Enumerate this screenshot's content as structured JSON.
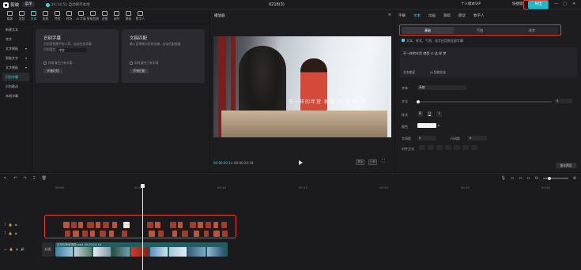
{
  "titlebar": {
    "app_name": "剪映",
    "menu_label": "菜单",
    "autosave": "14:14:51 自动保存本地",
    "doc_title": "0218(3)",
    "shortcuts": "快捷键",
    "pro_member": "个人版本VIP",
    "export_label": "导出",
    "win_min": "—",
    "win_max": "□",
    "win_close": "✕"
  },
  "toolbar": {
    "tools": [
      {
        "label": "媒体",
        "icon": "media-icon"
      },
      {
        "label": "音频",
        "icon": "audio-icon"
      },
      {
        "label": "文本",
        "icon": "text-icon",
        "active": true
      },
      {
        "label": "贴纸",
        "icon": "sticker-icon"
      },
      {
        "label": "特效",
        "icon": "effects-icon"
      },
      {
        "label": "转场",
        "icon": "transition-icon"
      },
      {
        "label": "AI 字幕",
        "icon": "ai-caption-icon"
      },
      {
        "label": "智能包装",
        "icon": "smart-pack-icon"
      },
      {
        "label": "滤镜",
        "icon": "filter-icon"
      },
      {
        "label": "调节",
        "icon": "adjust-icon"
      },
      {
        "label": "模板",
        "icon": "template-icon"
      },
      {
        "label": "数字人",
        "icon": "avatar-icon"
      }
    ]
  },
  "sidebar": {
    "items": [
      {
        "label": "新建文本"
      },
      {
        "label": "花字"
      },
      {
        "label": "文字模板"
      },
      {
        "label": "智能文字"
      },
      {
        "label": "文字模板"
      },
      {
        "label": "识别字幕",
        "active": true
      },
      {
        "label": "识别歌词"
      },
      {
        "label": "本地字幕"
      }
    ]
  },
  "content": {
    "card1": {
      "title": "识别字幕",
      "desc": "识别音视频中的人声，自动生成字幕",
      "lang_label": "识别语言",
      "lang_value": "中文",
      "check_label": "同时清空已有字幕",
      "button": "开始识别"
    },
    "card2": {
      "title": "文稿匹配",
      "desc": "输入音视频对应的文稿，自动匹配画面",
      "check_label": "同时清空已有字幕",
      "button": "开始匹配"
    }
  },
  "player": {
    "title": "播放器",
    "subtitle_text": "不一样的年货 就是 小 这 样 梦",
    "timecode_current": "00:00:00:14",
    "timecode_duration": "00:00:24:18",
    "btn_original": "原始",
    "btn_ratio": "比例"
  },
  "rpanel": {
    "tabs": [
      {
        "label": "字幕"
      },
      {
        "label": "文本",
        "active": true
      },
      {
        "label": "动画"
      },
      {
        "label": "跟踪"
      },
      {
        "label": "朗读"
      },
      {
        "label": "数字人"
      }
    ],
    "segments": [
      {
        "label": "基础",
        "active": true
      },
      {
        "label": "气泡"
      },
      {
        "label": "花字"
      }
    ],
    "apply_option": "文本、样式、气泡、花字应用到全部字幕",
    "text_content": "不一样的年货 就是 小 这 样 梦",
    "text_btn1": "文本朗读",
    "text_btn2": "AI 智能优化",
    "props": {
      "font_label": "字体",
      "font_value": "系统",
      "size_label": "字号",
      "size_value": "5",
      "style_label": "样式",
      "style_bold": "B",
      "style_underline": "U",
      "style_italic": "I",
      "color_label": "颜色",
      "charspace_label": "字间距",
      "charspace_value": "0",
      "linespace_label": "行间距",
      "linespace_value": "0",
      "align_label": "对齐方式"
    },
    "save_preset": "保存预设"
  },
  "timeline": {
    "ruler": [
      "00:00",
      "00:05",
      "00:10",
      "00:15",
      "00:20",
      "00:25",
      "00:30"
    ],
    "cover_label": "封面",
    "video_clip_label": "过年的故事视频.mp4  00:00:24:18"
  },
  "colors": {
    "accent": "#3bd6e0",
    "highlight_box": "#e8402f",
    "subtitle_clip": "#b8553a",
    "video_clip": "#1f5f63"
  }
}
